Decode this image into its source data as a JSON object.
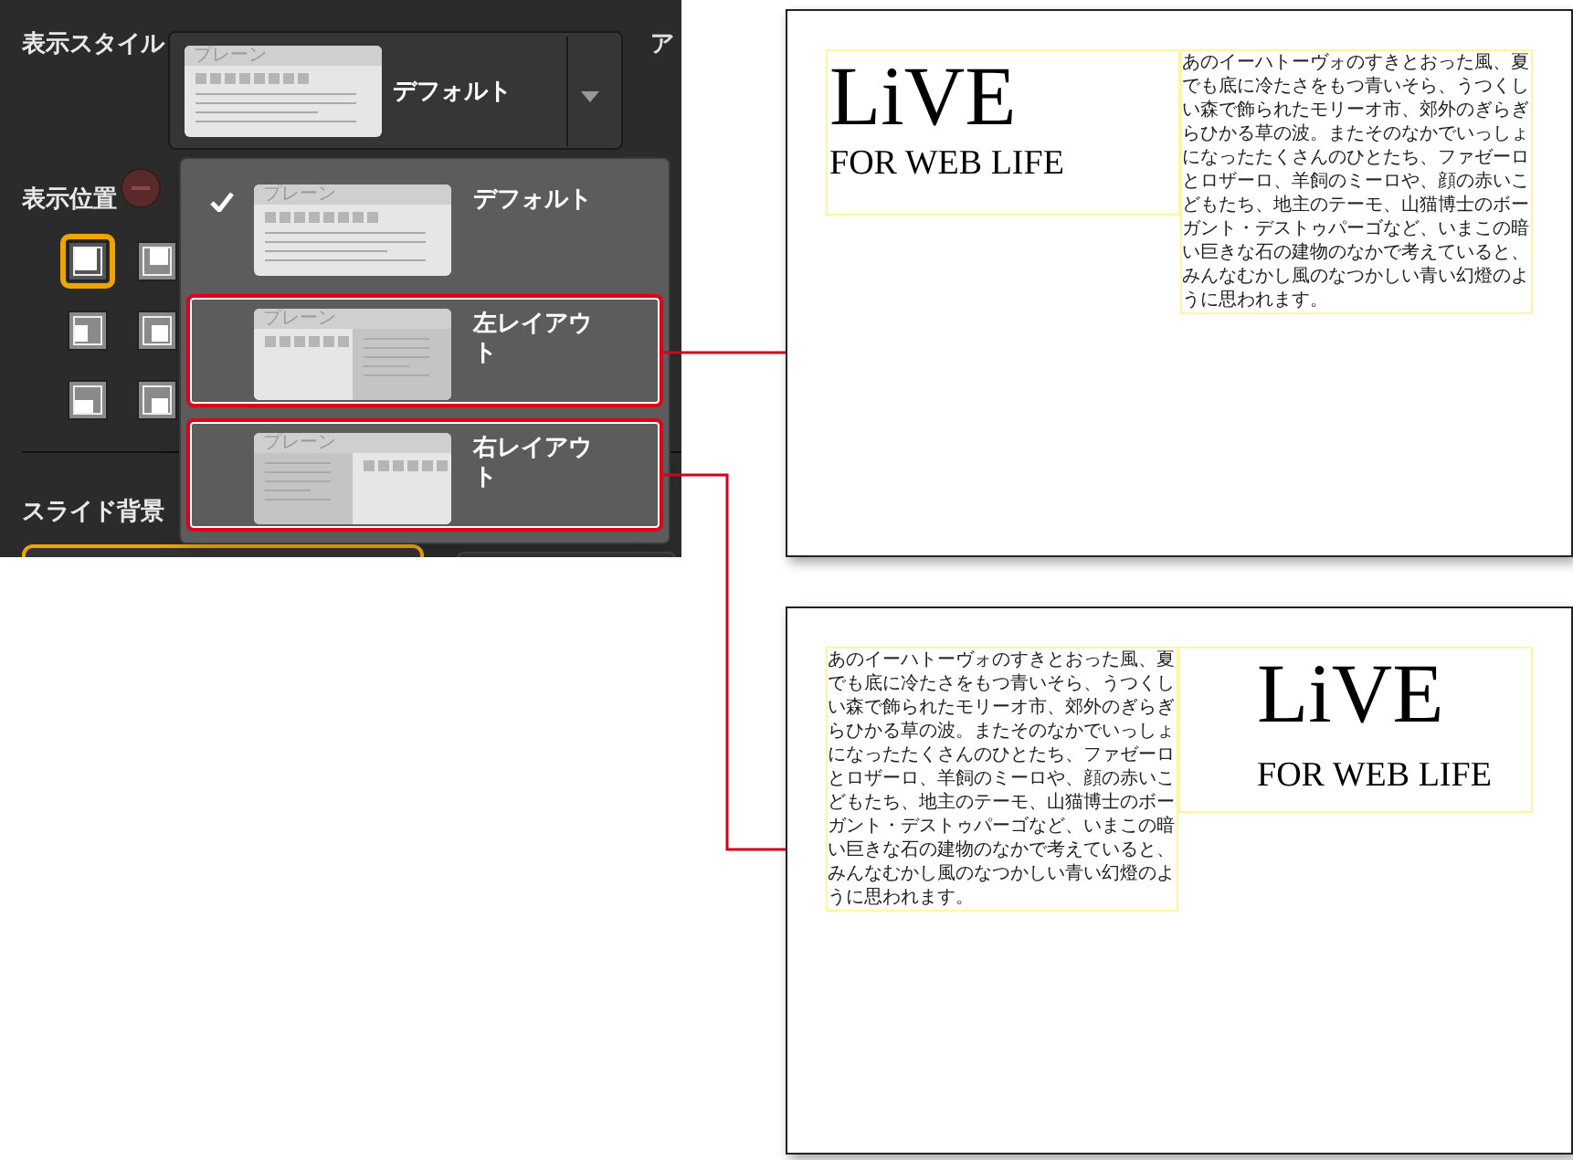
{
  "panel": {
    "style_label": "表示スタイル",
    "side_label": "ア",
    "style_select": {
      "value": "デフォルト",
      "kind": "default",
      "caption": "プレーン"
    },
    "position_label": "表示位置",
    "positions": [
      {
        "kind": "top-left",
        "selected": true
      },
      {
        "kind": "top",
        "selected": false
      },
      {
        "kind": "left",
        "selected": false
      },
      {
        "kind": "center",
        "selected": false
      },
      {
        "kind": "bottom-left",
        "selected": false
      },
      {
        "kind": "bottom",
        "selected": false
      }
    ],
    "background_label": "スライド背景"
  },
  "dropdown": [
    {
      "label": "デフォルト",
      "kind": "default",
      "caption": "プレーン",
      "checked": true,
      "highlighted": false
    },
    {
      "label": "左レイアウト",
      "kind": "left",
      "caption": "プレーン",
      "checked": false,
      "highlighted": true
    },
    {
      "label": "右レイアウト",
      "kind": "right",
      "caption": "プレーン",
      "checked": false,
      "highlighted": true
    }
  ],
  "slides": [
    {
      "kind": "left",
      "title": "LiVE",
      "subtitle": "FOR WEB LIFE",
      "body": "あのイーハトーヴォのすきとおった風、夏でも底に冷たさをもつ青いそら、うつくしい森で飾られたモリーオ市、郊外のぎらぎらひかる草の波。またそのなかでいっしょになったたくさんのひとたち、ファゼーロとロザーロ、羊飼のミーロや、顔の赤いこどもたち、地主のテーモ、山猫博士のボーガント・デストゥパーゴなど、いまこの暗い巨きな石の建物のなかで考えていると、みんなむかし風のなつかしい青い幻燈のように思われます。"
    },
    {
      "kind": "right",
      "title": "LiVE",
      "subtitle": "FOR WEB LIFE",
      "body": "あのイーハトーヴォのすきとおった風、夏でも底に冷たさをもつ青いそら、うつくしい森で飾られたモリーオ市、郊外のぎらぎらひかる草の波。またそのなかでいっしょになったたくさんのひとたち、ファゼーロとロザーロ、羊飼のミーロや、顔の赤いこどもたち、地主のテーモ、山猫博士のボーガント・デストゥパーゴなど、いまこの暗い巨きな石の建物のなかで考えていると、みんなむかし風のなつかしい青い幻燈のように思われます。"
    }
  ]
}
